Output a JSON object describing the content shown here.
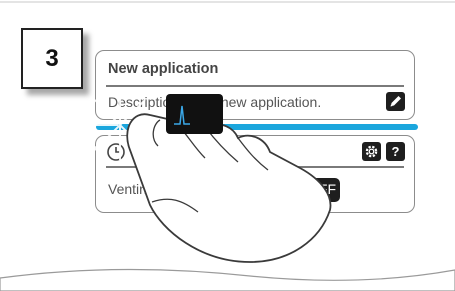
{
  "step": {
    "number": "3"
  },
  "application_card": {
    "title": "New application",
    "description": "Description of the new application.",
    "edit_icon": "pencil-icon"
  },
  "venting_card": {
    "label": "Venting",
    "toggle_state": "OFF",
    "mode_icon": "clock-icon",
    "settings_icon": "gear-icon",
    "help_icon": "question-icon",
    "help_text": "?"
  },
  "colors": {
    "selection_bar": "#1aa6dd",
    "button_bg": "#1e1e1e",
    "border": "#8c8c8c"
  }
}
